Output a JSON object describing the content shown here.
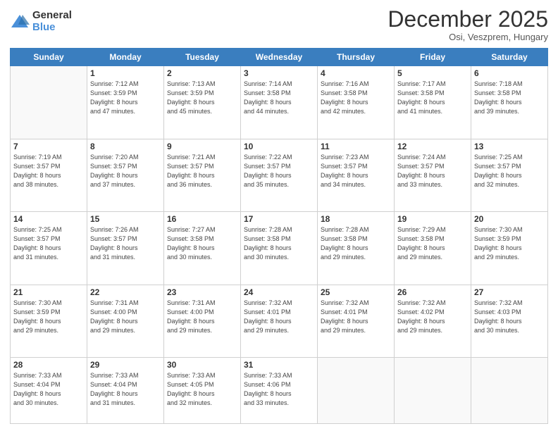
{
  "logo": {
    "general": "General",
    "blue": "Blue"
  },
  "title": "December 2025",
  "location": "Osi, Veszprem, Hungary",
  "days_of_week": [
    "Sunday",
    "Monday",
    "Tuesday",
    "Wednesday",
    "Thursday",
    "Friday",
    "Saturday"
  ],
  "weeks": [
    [
      {
        "day": "",
        "info": ""
      },
      {
        "day": "1",
        "info": "Sunrise: 7:12 AM\nSunset: 3:59 PM\nDaylight: 8 hours\nand 47 minutes."
      },
      {
        "day": "2",
        "info": "Sunrise: 7:13 AM\nSunset: 3:59 PM\nDaylight: 8 hours\nand 45 minutes."
      },
      {
        "day": "3",
        "info": "Sunrise: 7:14 AM\nSunset: 3:58 PM\nDaylight: 8 hours\nand 44 minutes."
      },
      {
        "day": "4",
        "info": "Sunrise: 7:16 AM\nSunset: 3:58 PM\nDaylight: 8 hours\nand 42 minutes."
      },
      {
        "day": "5",
        "info": "Sunrise: 7:17 AM\nSunset: 3:58 PM\nDaylight: 8 hours\nand 41 minutes."
      },
      {
        "day": "6",
        "info": "Sunrise: 7:18 AM\nSunset: 3:58 PM\nDaylight: 8 hours\nand 39 minutes."
      }
    ],
    [
      {
        "day": "7",
        "info": "Sunrise: 7:19 AM\nSunset: 3:57 PM\nDaylight: 8 hours\nand 38 minutes."
      },
      {
        "day": "8",
        "info": "Sunrise: 7:20 AM\nSunset: 3:57 PM\nDaylight: 8 hours\nand 37 minutes."
      },
      {
        "day": "9",
        "info": "Sunrise: 7:21 AM\nSunset: 3:57 PM\nDaylight: 8 hours\nand 36 minutes."
      },
      {
        "day": "10",
        "info": "Sunrise: 7:22 AM\nSunset: 3:57 PM\nDaylight: 8 hours\nand 35 minutes."
      },
      {
        "day": "11",
        "info": "Sunrise: 7:23 AM\nSunset: 3:57 PM\nDaylight: 8 hours\nand 34 minutes."
      },
      {
        "day": "12",
        "info": "Sunrise: 7:24 AM\nSunset: 3:57 PM\nDaylight: 8 hours\nand 33 minutes."
      },
      {
        "day": "13",
        "info": "Sunrise: 7:25 AM\nSunset: 3:57 PM\nDaylight: 8 hours\nand 32 minutes."
      }
    ],
    [
      {
        "day": "14",
        "info": "Sunrise: 7:25 AM\nSunset: 3:57 PM\nDaylight: 8 hours\nand 31 minutes."
      },
      {
        "day": "15",
        "info": "Sunrise: 7:26 AM\nSunset: 3:57 PM\nDaylight: 8 hours\nand 31 minutes."
      },
      {
        "day": "16",
        "info": "Sunrise: 7:27 AM\nSunset: 3:58 PM\nDaylight: 8 hours\nand 30 minutes."
      },
      {
        "day": "17",
        "info": "Sunrise: 7:28 AM\nSunset: 3:58 PM\nDaylight: 8 hours\nand 30 minutes."
      },
      {
        "day": "18",
        "info": "Sunrise: 7:28 AM\nSunset: 3:58 PM\nDaylight: 8 hours\nand 29 minutes."
      },
      {
        "day": "19",
        "info": "Sunrise: 7:29 AM\nSunset: 3:58 PM\nDaylight: 8 hours\nand 29 minutes."
      },
      {
        "day": "20",
        "info": "Sunrise: 7:30 AM\nSunset: 3:59 PM\nDaylight: 8 hours\nand 29 minutes."
      }
    ],
    [
      {
        "day": "21",
        "info": "Sunrise: 7:30 AM\nSunset: 3:59 PM\nDaylight: 8 hours\nand 29 minutes."
      },
      {
        "day": "22",
        "info": "Sunrise: 7:31 AM\nSunset: 4:00 PM\nDaylight: 8 hours\nand 29 minutes."
      },
      {
        "day": "23",
        "info": "Sunrise: 7:31 AM\nSunset: 4:00 PM\nDaylight: 8 hours\nand 29 minutes."
      },
      {
        "day": "24",
        "info": "Sunrise: 7:32 AM\nSunset: 4:01 PM\nDaylight: 8 hours\nand 29 minutes."
      },
      {
        "day": "25",
        "info": "Sunrise: 7:32 AM\nSunset: 4:01 PM\nDaylight: 8 hours\nand 29 minutes."
      },
      {
        "day": "26",
        "info": "Sunrise: 7:32 AM\nSunset: 4:02 PM\nDaylight: 8 hours\nand 29 minutes."
      },
      {
        "day": "27",
        "info": "Sunrise: 7:32 AM\nSunset: 4:03 PM\nDaylight: 8 hours\nand 30 minutes."
      }
    ],
    [
      {
        "day": "28",
        "info": "Sunrise: 7:33 AM\nSunset: 4:04 PM\nDaylight: 8 hours\nand 30 minutes."
      },
      {
        "day": "29",
        "info": "Sunrise: 7:33 AM\nSunset: 4:04 PM\nDaylight: 8 hours\nand 31 minutes."
      },
      {
        "day": "30",
        "info": "Sunrise: 7:33 AM\nSunset: 4:05 PM\nDaylight: 8 hours\nand 32 minutes."
      },
      {
        "day": "31",
        "info": "Sunrise: 7:33 AM\nSunset: 4:06 PM\nDaylight: 8 hours\nand 33 minutes."
      },
      {
        "day": "",
        "info": ""
      },
      {
        "day": "",
        "info": ""
      },
      {
        "day": "",
        "info": ""
      }
    ]
  ]
}
